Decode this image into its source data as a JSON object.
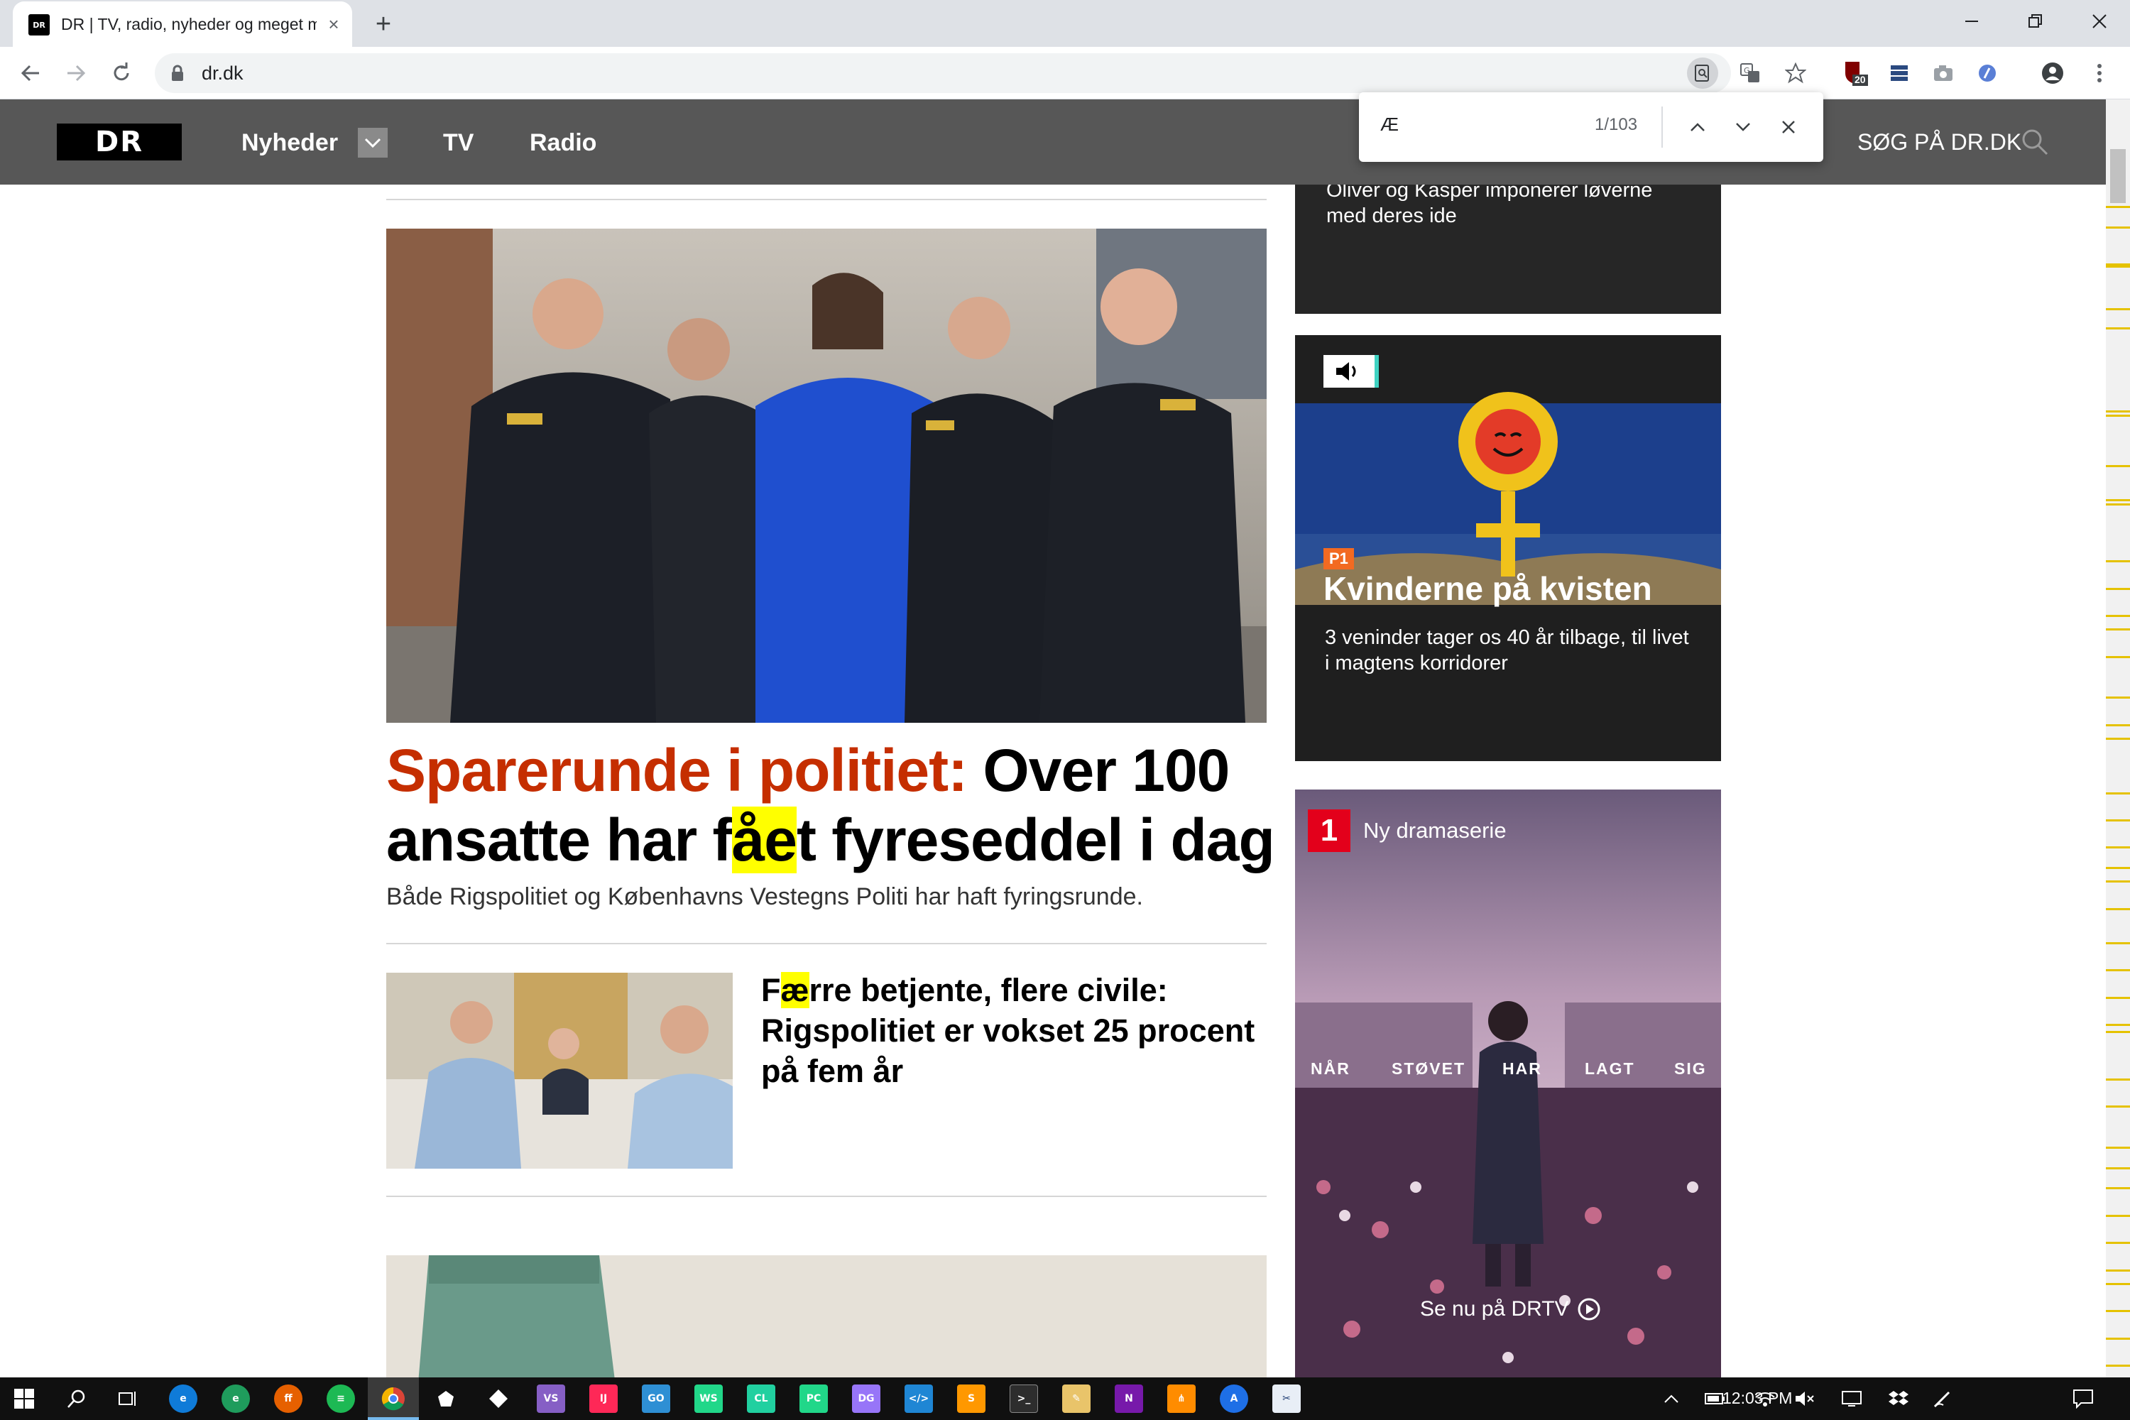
{
  "browser": {
    "tab_title": "DR | TV, radio, nyheder og meget mere",
    "tab_favicon": "DR",
    "tab_close": "×",
    "new_tab": "+",
    "url": "dr.dk",
    "find": {
      "query": "Æ",
      "count": "1/103"
    },
    "extension_badge": "20"
  },
  "site": {
    "logo": "DR",
    "nav": [
      {
        "label": "Nyheder"
      },
      {
        "label": "TV"
      },
      {
        "label": "Radio"
      }
    ],
    "search_label": "SØG PÅ DR.DK"
  },
  "main": {
    "lead": {
      "kicker": "Sparerunde i politiet:",
      "title_part1": " Over 100 ansatte har f",
      "title_highlight": "åe",
      "title_part2": "t fyreseddel i dag",
      "subtitle": "Både Rigspolitiet og Københavns Vestegns Politi har haft fyringsrunde."
    },
    "second": {
      "title_pre": "F",
      "title_highlight": "æ",
      "title_post": "rre betjente, flere civile: Rigspolitiet er vokset 25 procent på fem år"
    }
  },
  "sidebar": {
    "top_card": "Oliver og Kasper imponerer løverne med deres ide",
    "p1_card": {
      "badge": "P1",
      "title": "Kvinderne på kvisten",
      "text": "3 veninder tager os 40 år tilbage, til livet i magtens korridorer"
    },
    "dr1_card": {
      "channel": "1",
      "label": "Ny dramaserie",
      "words": [
        "NÅR",
        "STØVET",
        "HAR",
        "LAGT",
        "SIG"
      ],
      "cta": "Se nu på DRTV"
    }
  },
  "taskbar": {
    "time": "12:03 PM"
  },
  "colors": {
    "dr_header": "#575757",
    "kicker": "#c52e00",
    "highlight": "#ffff00",
    "find_tick": "#e5c200"
  }
}
